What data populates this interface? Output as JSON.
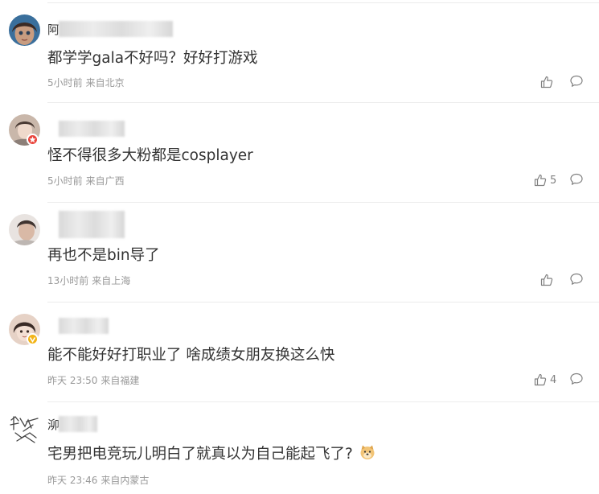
{
  "comments": [
    {
      "name_visible": "阿",
      "text": "都学学gala不好吗？好好打游戏",
      "time": "5小时前",
      "location": "来自北京",
      "likes": "",
      "avatar_bg": "#3a6f9c",
      "badge_color": ""
    },
    {
      "name_visible": "",
      "text": "怪不得很多大粉都是cosplayer",
      "time": "5小时前",
      "location": "来自广西",
      "likes": "5",
      "avatar_bg": "#c9b7aa",
      "badge_color": "#e9463d"
    },
    {
      "name_visible": "",
      "text": "再也不是bin导了",
      "time": "13小时前",
      "location": "来自上海",
      "likes": "",
      "avatar_bg": "#d4cfcc",
      "badge_color": ""
    },
    {
      "name_visible": "",
      "text": "能不能好好打职业了 啥成绩女朋友换这么快",
      "time": "昨天 23:50",
      "location": "来自福建",
      "likes": "4",
      "avatar_bg": "#e6d2c6",
      "badge_color": "#f2b418"
    },
    {
      "name_visible": "泖",
      "text": "宅男把电竞玩儿明白了就真以为自己能起飞了?",
      "time": "昨天 23:46",
      "location": "来自内蒙古",
      "likes": "",
      "avatar_bg": "#ffffff",
      "badge_color": ""
    }
  ],
  "icons": {
    "like": "thumbs-up-icon",
    "reply": "comment-bubble-icon",
    "emoji": "doge-emoji-icon"
  },
  "colors": {
    "text": "#333333",
    "meta": "#999999",
    "icon": "#808080",
    "divider": "#ececec"
  }
}
